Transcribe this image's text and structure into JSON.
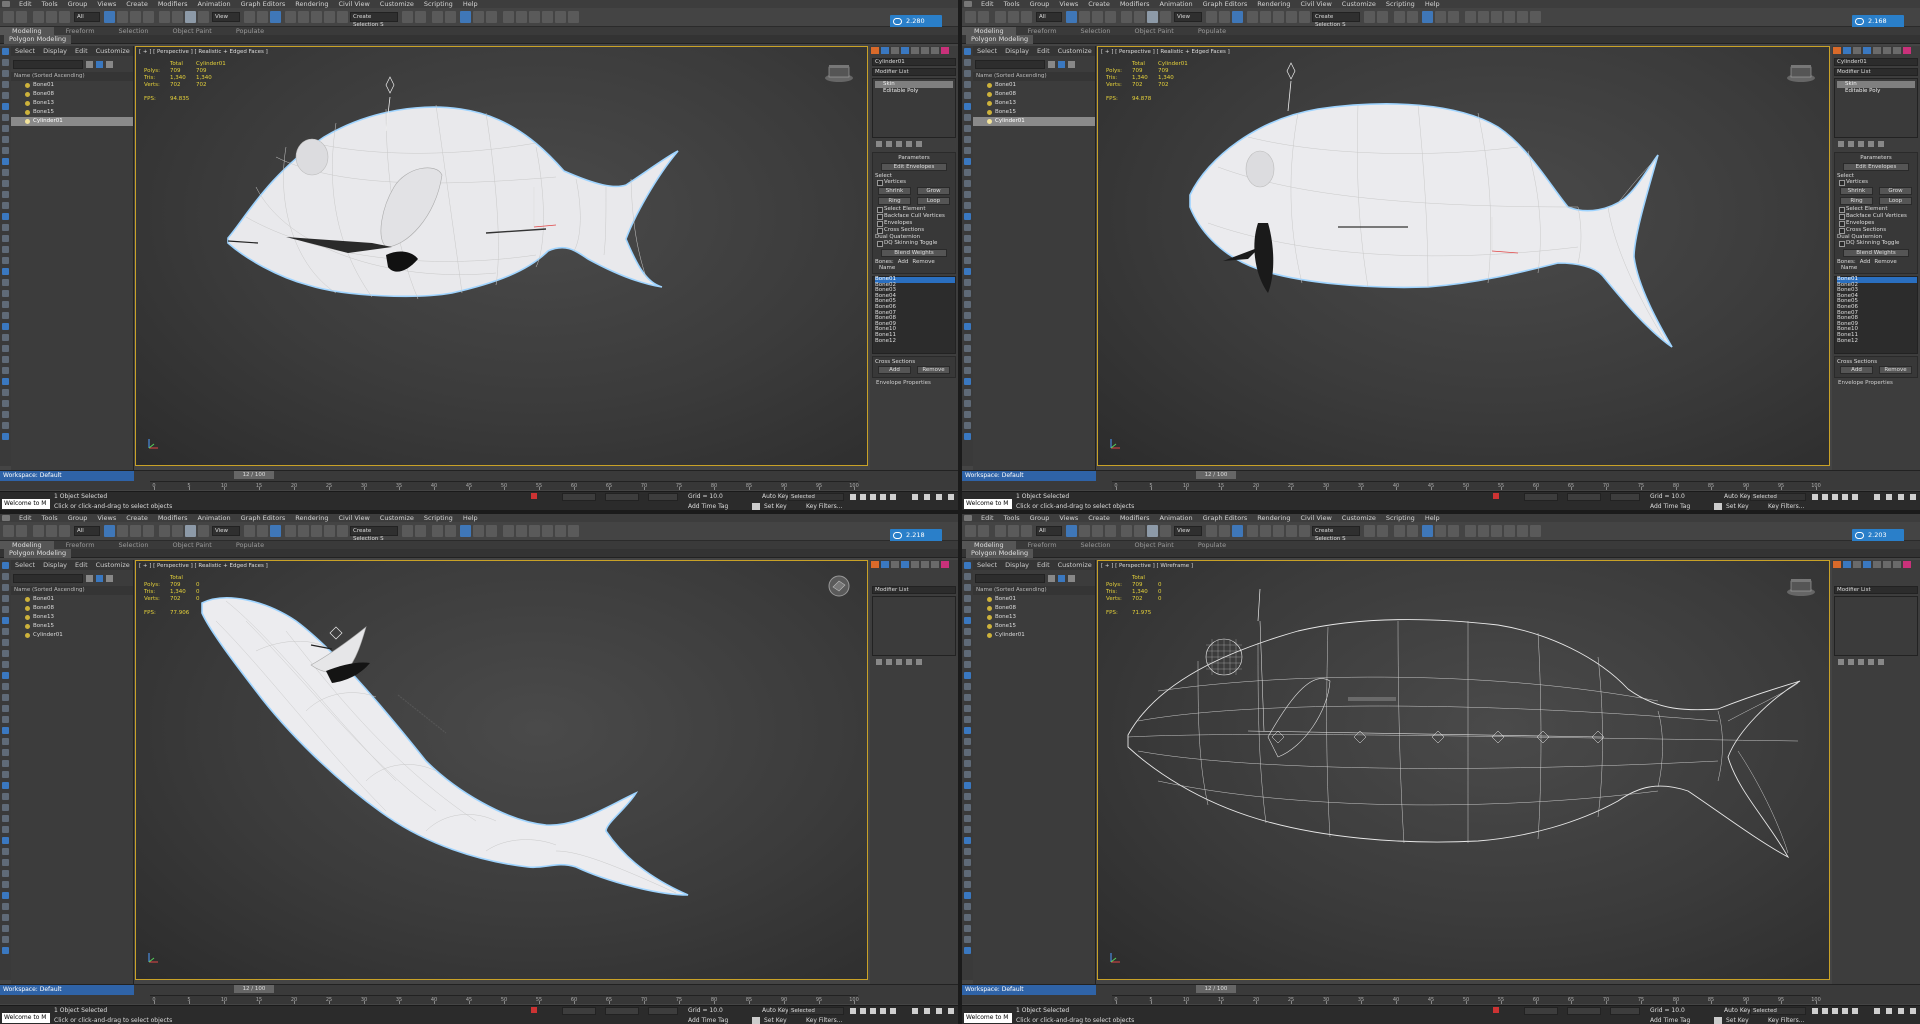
{
  "menu": [
    "Edit",
    "Tools",
    "Group",
    "Views",
    "Create",
    "Modifiers",
    "Animation",
    "Graph Editors",
    "Rendering",
    "Civil View",
    "Customize",
    "Scripting",
    "Help"
  ],
  "toolbar": {
    "filter_dropdown": "All",
    "view_dropdown": "View",
    "selection_set_placeholder": "Create Selection S"
  },
  "ribbon_tabs": [
    "Modeling",
    "Freeform",
    "Selection",
    "Object Paint",
    "Populate"
  ],
  "ribbon_sublabel": "Polygon Modeling",
  "scene_explorer": {
    "tabs": [
      "Select",
      "Display",
      "Edit",
      "Customize"
    ],
    "column_header": "Name (Sorted Ascending)",
    "items": [
      "Bone01",
      "Bone08",
      "Bone13",
      "Bone15",
      "Cylinder01"
    ]
  },
  "stats_labels": {
    "polys": "Polys:",
    "tris": "Tris:",
    "verts": "Verts:",
    "fps": "FPS:",
    "total": "Total"
  },
  "command_panel": {
    "modifier_list": "Modifier List",
    "stack": [
      "Skin",
      "Editable Poly"
    ],
    "parameters": "Parameters",
    "edit_envelopes": "Edit Envelopes",
    "select_group": "Select",
    "vertices": "Vertices",
    "shrink": "Shrink",
    "grow": "Grow",
    "ring": "Ring",
    "loop": "Loop",
    "select_element": "Select Element",
    "backface_cull": "Backface Cull Vertices",
    "envelopes": "Envelopes",
    "cross_sections": "Cross Sections",
    "dual_quaternion": "Dual Quaternion",
    "dq_toggle": "DQ Skinning Toggle",
    "blend_weights": "Blend Weights",
    "bones_label": "Bones:",
    "add": "Add",
    "remove": "Remove",
    "name_col": "Name",
    "bones": [
      "Bone01",
      "Bone02",
      "Bone03",
      "Bone04",
      "Bone05",
      "Bone06",
      "Bone07",
      "Bone08",
      "Bone09",
      "Bone10",
      "Bone11",
      "Bone12"
    ],
    "cross_sections_group": "Cross Sections",
    "envelope_properties": "Envelope Properties"
  },
  "timeline": {
    "workspace": "Workspace: Default",
    "frame_slider": "12 / 100",
    "ticks": [
      0,
      5,
      10,
      15,
      20,
      25,
      30,
      35,
      40,
      45,
      50,
      55,
      60,
      65,
      70,
      75,
      80,
      85,
      90,
      95,
      100
    ]
  },
  "status": {
    "welcome": "Welcome to M",
    "objects_selected": "1 Object Selected",
    "hint": "Click or click-and-drag to select objects",
    "grid": "Grid = 10.0",
    "add_time_tag": "Add Time Tag",
    "auto_key": "Auto Key",
    "set_key": "Set Key",
    "selected": "Selected",
    "key_filters": "Key Filters..."
  },
  "panes": [
    {
      "id": "tl",
      "viewport_label": "[ + ] [ Perspective ] [ Realistic + Edged Faces ]",
      "stat_target": "Cylinder01",
      "polys": [
        "709",
        "709"
      ],
      "tris": [
        "1,340",
        "1,340"
      ],
      "verts": [
        "702",
        "702"
      ],
      "fps": "94.835",
      "cloud": "2.280 KB/s",
      "mode": "skin"
    },
    {
      "id": "tr",
      "viewport_label": "[ + ] [ Perspective ] [ Realistic + Edged Faces ]",
      "stat_target": "Cylinder01",
      "polys": [
        "709",
        "709"
      ],
      "tris": [
        "1,340",
        "1,340"
      ],
      "verts": [
        "702",
        "702"
      ],
      "fps": "94.878",
      "cloud": "2.168 KB/s",
      "mode": "skin"
    },
    {
      "id": "bl",
      "viewport_label": "[ + ] [ Perspective ] [ Realistic + Edged Faces ]",
      "stat_target": "",
      "polys": [
        "709",
        "0"
      ],
      "tris": [
        "1,340",
        "0"
      ],
      "verts": [
        "702",
        "0"
      ],
      "fps": "77.906",
      "cloud": "2.218 KB/s",
      "mode": "empty"
    },
    {
      "id": "br",
      "viewport_label": "[ + ] [ Perspective ] [ Wireframe ]",
      "stat_target": "",
      "polys": [
        "709",
        "0"
      ],
      "tris": [
        "1,340",
        "0"
      ],
      "verts": [
        "702",
        "0"
      ],
      "fps": "71.975",
      "cloud": "2.203 KB/s",
      "mode": "empty"
    }
  ],
  "colors": {
    "accent": "#2a7fc9",
    "viewport_border": "#c9a227",
    "stats": "#e6d23a"
  }
}
